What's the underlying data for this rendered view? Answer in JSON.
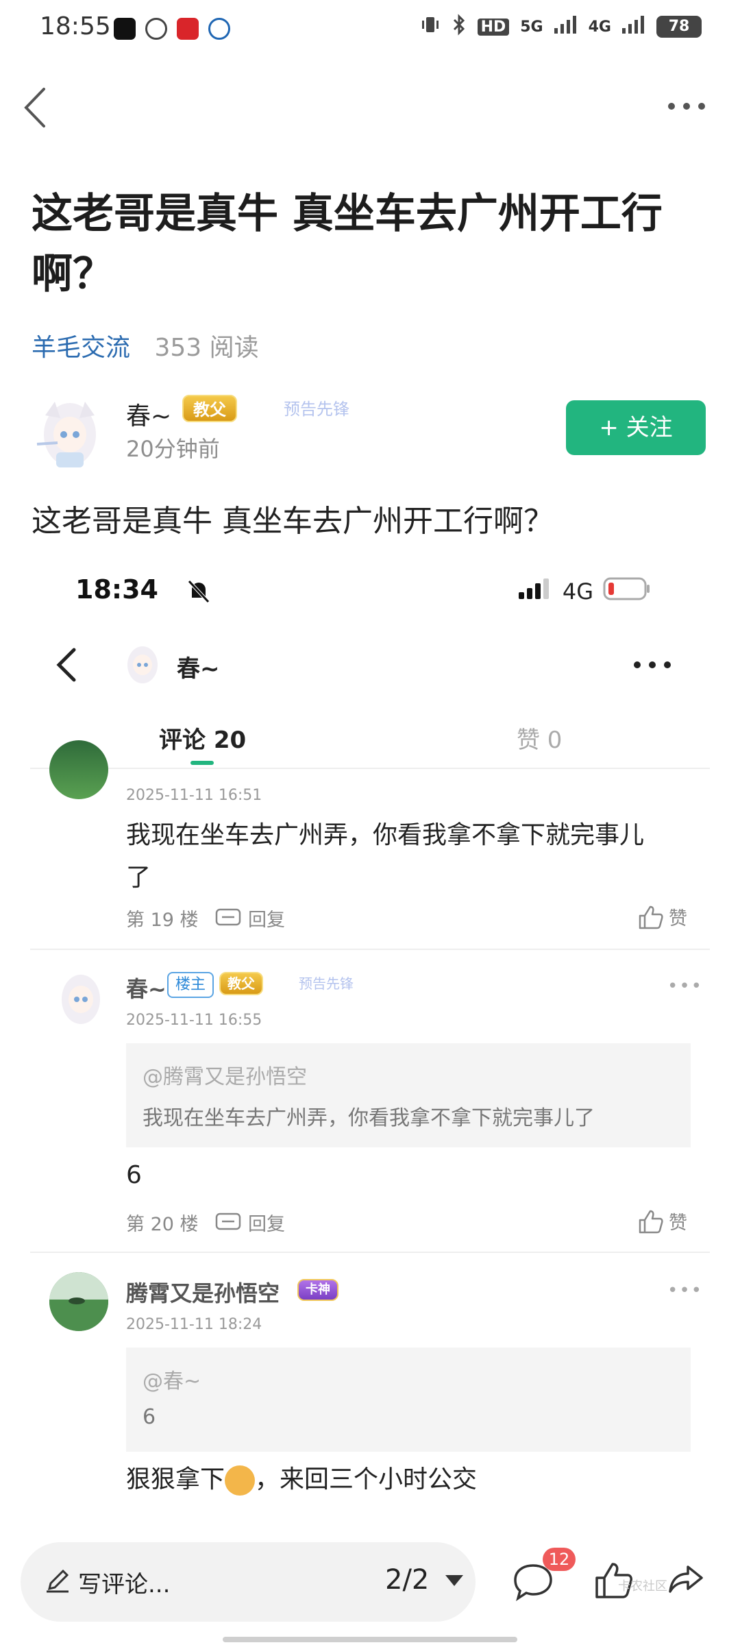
{
  "status_bar": {
    "time": "18:55",
    "network_5g": "5G",
    "network_4g": "4G",
    "hd": "HD",
    "battery": "78"
  },
  "post": {
    "title": "这老哥是真牛 真坐车去广州开工行啊？",
    "forum": "羊毛交流",
    "reads": "353 阅读",
    "author": {
      "name": "春~",
      "badge": "教父",
      "badge2": "预告先锋",
      "time": "20分钟前"
    },
    "follow_label": "+ 关注",
    "body": "这老哥是真牛 真坐车去广州开工行啊？"
  },
  "embedded": {
    "time": "18:34",
    "network": "4G",
    "header_name": "春~",
    "tabs": {
      "comments": "评论 20",
      "likes": "赞 0"
    },
    "comments": [
      {
        "time": "2025-11-11 16:51",
        "text_line1": "我现在坐车去广州弄，你看我拿不拿下就完事儿",
        "text_line2": "了",
        "floor": "第 19 楼",
        "reply": "回复",
        "like": "赞"
      },
      {
        "name": "春~",
        "owner_badge": "楼主",
        "badge": "教父",
        "badge2": "预告先锋",
        "time": "2025-11-11 16:55",
        "quote_user": "@腾霄又是孙悟空",
        "quote_text": "我现在坐车去广州弄，你看我拿不拿下就完事儿了",
        "text": "6",
        "floor": "第 20 楼",
        "reply": "回复",
        "like": "赞",
        "more": "•••"
      },
      {
        "name": "腾霄又是孙悟空",
        "badge": "卡神",
        "time": "2025-11-11 18:24",
        "quote_user": "@春~",
        "quote_text": "6",
        "text_before": "狠狠拿下",
        "text_after": "，来回三个小时公交",
        "more": "•••"
      }
    ]
  },
  "bottom_bar": {
    "compose_placeholder": "写评论...",
    "pager": "2/2",
    "comment_count": "12",
    "watermark": "卡农社区"
  },
  "colors": {
    "accent_green": "#22b57f",
    "forum_blue": "#2b6bb0",
    "badge_red": "#ef5a5a"
  }
}
